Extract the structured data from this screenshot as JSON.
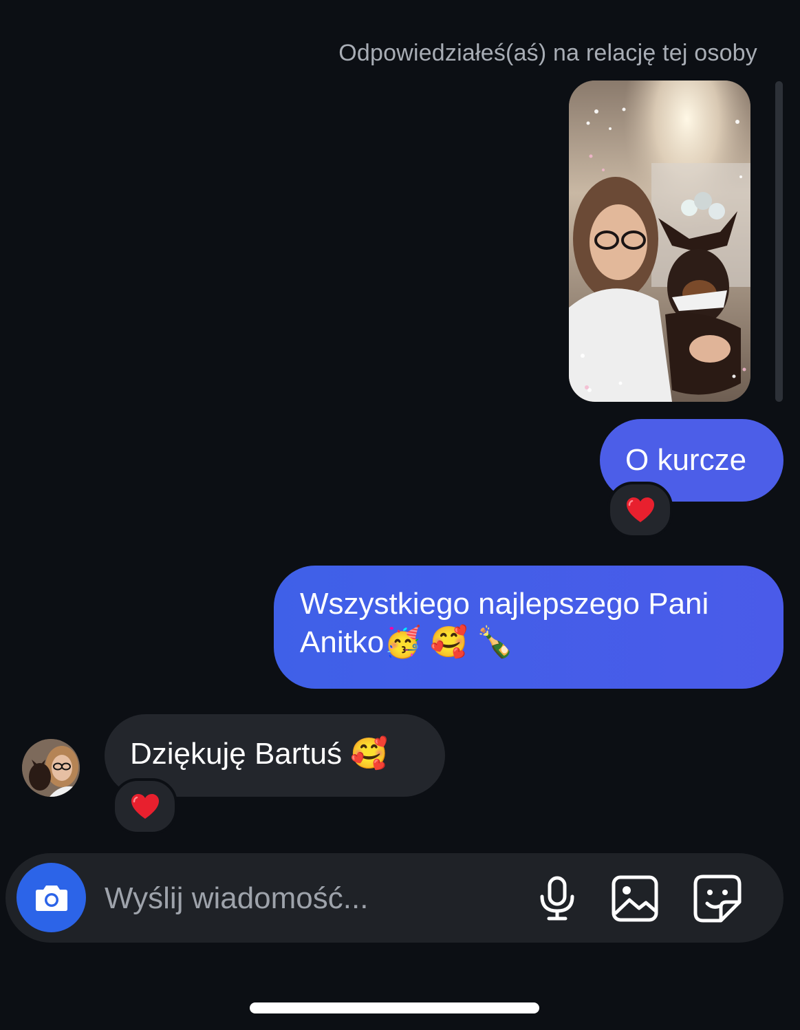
{
  "conversation": {
    "story_reply_caption": "Odpowiedziałeś(aś) na relację tej osoby",
    "messages": [
      {
        "direction": "outgoing",
        "text": "O kurcze",
        "reaction": "❤️"
      },
      {
        "direction": "outgoing",
        "text": "Wszystkiego najlepszego Pani Anitko",
        "trailing_emojis": [
          "🥳",
          "🥰",
          "🍾"
        ]
      },
      {
        "direction": "incoming",
        "text": "Dziękuję Bartuś",
        "trailing_emojis": [
          "🥰"
        ],
        "reaction": "❤️"
      }
    ]
  },
  "composer": {
    "placeholder": "Wyślij wiadomość...",
    "icons": [
      "camera-icon",
      "microphone-icon",
      "gallery-icon",
      "sticker-icon"
    ]
  },
  "colors": {
    "background": "#0c0f14",
    "outgoing_bubble": "#4c5ee8",
    "incoming_bubble": "#23262c",
    "camera_button": "#2c64e8",
    "muted_text": "#a8adb5"
  }
}
